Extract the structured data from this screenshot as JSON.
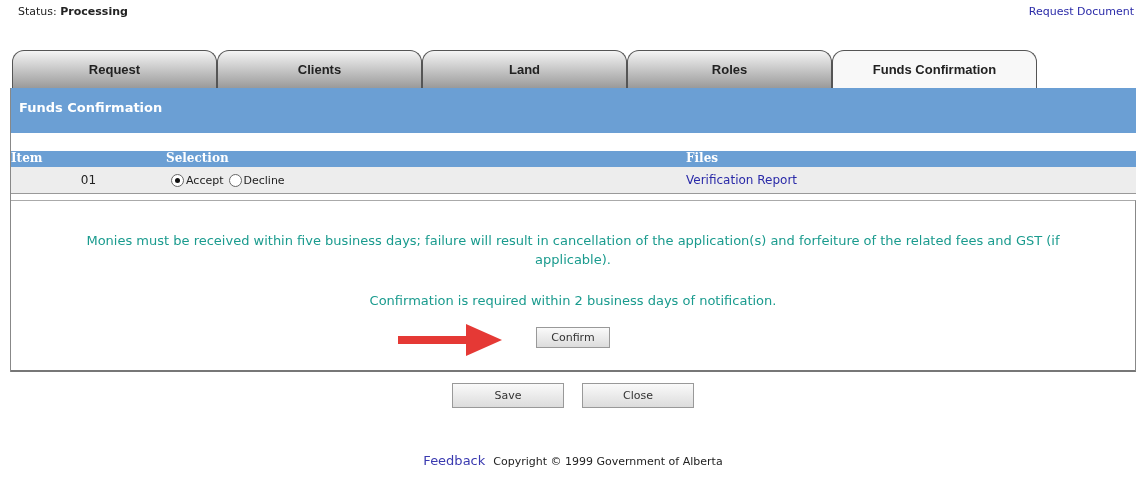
{
  "status": {
    "label": "Status:",
    "value": "Processing"
  },
  "header_link": "Request Document",
  "tabs": [
    {
      "label": "Request",
      "selected": false
    },
    {
      "label": "Clients",
      "selected": false
    },
    {
      "label": "Land",
      "selected": false
    },
    {
      "label": "Roles",
      "selected": false
    },
    {
      "label": "Funds Confirmation",
      "selected": true
    }
  ],
  "panel_title": "Funds Confirmation",
  "table": {
    "columns": [
      "Item",
      "Selection",
      "Files"
    ],
    "rows": [
      {
        "item": "01",
        "options": [
          {
            "label": "Accept",
            "selected": true
          },
          {
            "label": "Decline",
            "selected": false
          }
        ],
        "file": "Verification Report"
      }
    ]
  },
  "messages": [
    "Monies must be received within five business days; failure will result in cancellation of the application(s) and forfeiture of the related fees and GST (if applicable).",
    "Confirmation is required within 2 business days of notification."
  ],
  "confirm_button": "Confirm",
  "buttons": [
    "Save",
    "Close"
  ],
  "footer": {
    "link": "Feedback",
    "copyright": "Copyright © 1999 Government of Alberta"
  }
}
